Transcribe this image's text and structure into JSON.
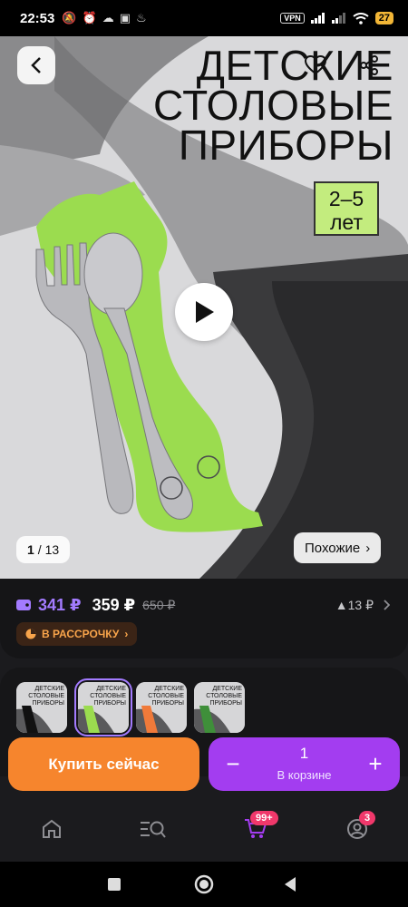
{
  "status_bar": {
    "time": "22:53",
    "vpn": "VPN",
    "battery": "27"
  },
  "product": {
    "title_lines": [
      "ДЕТСКИЕ",
      "СТОЛОВЫЕ",
      "ПРИБОРЫ"
    ],
    "age_lines": [
      "2–5",
      "лет"
    ],
    "image_counter_current": "1",
    "image_counter_total": "/ 13",
    "similar_label": "Похожие",
    "similar_chevron": "›"
  },
  "prices": {
    "wallet_price": "341 ₽",
    "price": "359 ₽",
    "old_price": "650 ₽",
    "delta": "▲13 ₽",
    "installment_label": "В РАССРОЧКУ",
    "installment_chevron": "›"
  },
  "variants": {
    "thumbs": [
      {
        "label": "ДЕТСКИЕ СТОЛОВЫЕ ПРИБОРЫ",
        "color": "#111111"
      },
      {
        "label": "ДЕТСКИЕ СТОЛОВЫЕ ПРИБОРЫ",
        "color": "#9bdc4f"
      },
      {
        "label": "ДЕТСКИЕ СТОЛОВЫЕ ПРИБОРЫ",
        "color": "#f07a3a"
      },
      {
        "label": "ДЕТСКИЕ СТОЛОВЫЕ ПРИБОРЫ",
        "color": "#3f8f3a"
      }
    ],
    "selected_index": 1
  },
  "actions": {
    "buy_now": "Купить сейчас",
    "cart_qty": "1",
    "cart_label": "В корзине",
    "minus": "−",
    "plus": "+"
  },
  "bottom_nav": {
    "cart_badge": "99+",
    "profile_badge": "3"
  },
  "colors": {
    "accent_purple": "#a33df0",
    "accent_orange": "#f6852d",
    "wallet_purple": "#a37bff",
    "felt_green": "#9bdc4f"
  }
}
